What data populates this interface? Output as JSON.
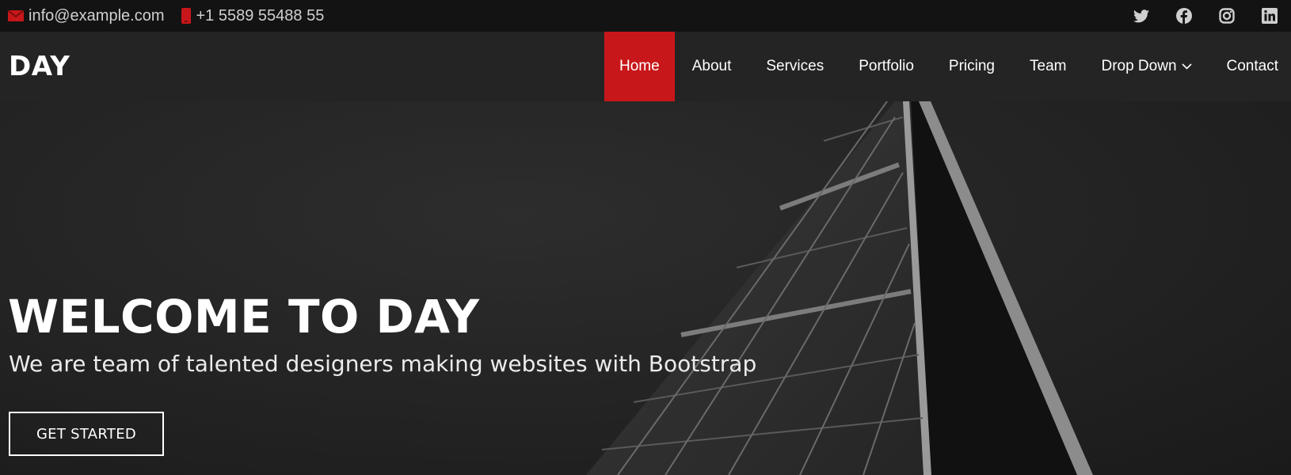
{
  "topbar": {
    "email": "info@example.com",
    "phone": "+1 5589 55488 55",
    "email_icon": "envelope-icon",
    "phone_icon": "phone-icon",
    "socials": [
      "twitter-icon",
      "facebook-icon",
      "instagram-icon",
      "linkedin-icon"
    ]
  },
  "header": {
    "logo": "DAY",
    "nav": [
      {
        "label": "Home",
        "active": true
      },
      {
        "label": "About"
      },
      {
        "label": "Services"
      },
      {
        "label": "Portfolio"
      },
      {
        "label": "Pricing"
      },
      {
        "label": "Team"
      },
      {
        "label": "Drop Down",
        "has_dropdown": true
      },
      {
        "label": "Contact"
      }
    ]
  },
  "hero": {
    "title": "WELCOME TO DAY",
    "subtitle": "We are team of talented designers making websites with Bootstrap",
    "cta_label": "GET STARTED"
  },
  "colors": {
    "accent": "#c8171a",
    "topbar_bg": "#131313",
    "header_bg": "#242424"
  }
}
